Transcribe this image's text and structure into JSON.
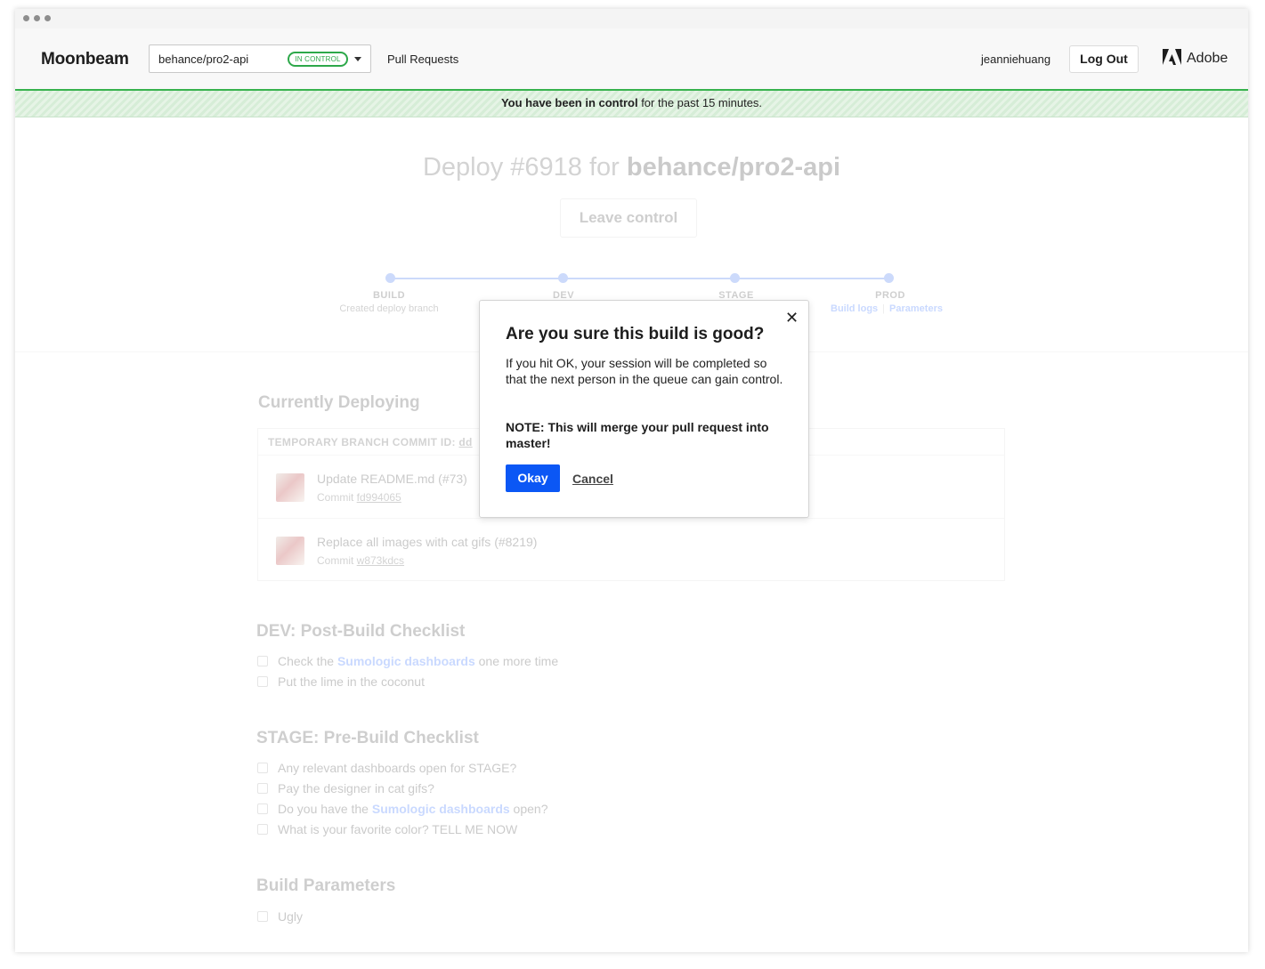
{
  "header": {
    "brand": "Moonbeam",
    "repo": "behance/pro2-api",
    "repo_badge": "IN CONTROL",
    "nav_pull_requests": "Pull Requests",
    "username": "jeanniehuang",
    "logout": "Log Out",
    "company": "Adobe",
    "accent_color": "#37b24d"
  },
  "banner": {
    "bold": "You have been in control",
    "rest": " for the past 15 minutes."
  },
  "page": {
    "title_prefix": "Deploy #6918 for ",
    "title_repo": "behance/pro2-api",
    "leave_button": "Leave control"
  },
  "pipeline": {
    "stages": [
      {
        "label": "BUILD",
        "sub": "Created deploy branch"
      },
      {
        "label": "DEV",
        "sub": ""
      },
      {
        "label": "STAGE",
        "sub": ""
      },
      {
        "label": "PROD",
        "links": [
          "Build logs",
          "Parameters"
        ]
      }
    ]
  },
  "deploying": {
    "title": "Currently Deploying",
    "header": "TEMPORARY BRANCH COMMIT ID: ",
    "header_id": "dd",
    "commits": [
      {
        "title": "Update README.md (#73)",
        "label": "Commit ",
        "hash": "fd994065"
      },
      {
        "title": "Replace all images with cat gifs (#8219)",
        "label": "Commit ",
        "hash": "w873kdcs"
      }
    ]
  },
  "dev_checklist": {
    "title": "DEV: Post-Build Checklist",
    "items": [
      {
        "pre": "Check the ",
        "link": "Sumologic dashboards",
        "post": " one more time"
      },
      {
        "pre": "Put the lime in the coconut",
        "link": "",
        "post": ""
      }
    ]
  },
  "stage_checklist": {
    "title": "STAGE: Pre-Build Checklist",
    "items": [
      {
        "pre": "Any relevant dashboards open for STAGE?",
        "link": "",
        "post": ""
      },
      {
        "pre": "Pay the designer in cat gifs?",
        "link": "",
        "post": ""
      },
      {
        "pre": "Do you have the ",
        "link": "Sumologic dashboards",
        "post": " open?"
      },
      {
        "pre": "What is your favorite color? TELL ME NOW",
        "link": "",
        "post": ""
      }
    ]
  },
  "build_params": {
    "title": "Build Parameters",
    "items": [
      {
        "pre": "Ugly",
        "link": "",
        "post": ""
      }
    ]
  },
  "modal": {
    "title": "Are you sure this build is good?",
    "body": "If you hit OK, your session will be completed so that the next person in the queue can gain control.",
    "note": "NOTE: This will merge your pull request into master!",
    "ok": "Okay",
    "cancel": "Cancel",
    "primary_color": "#0b57f5"
  }
}
